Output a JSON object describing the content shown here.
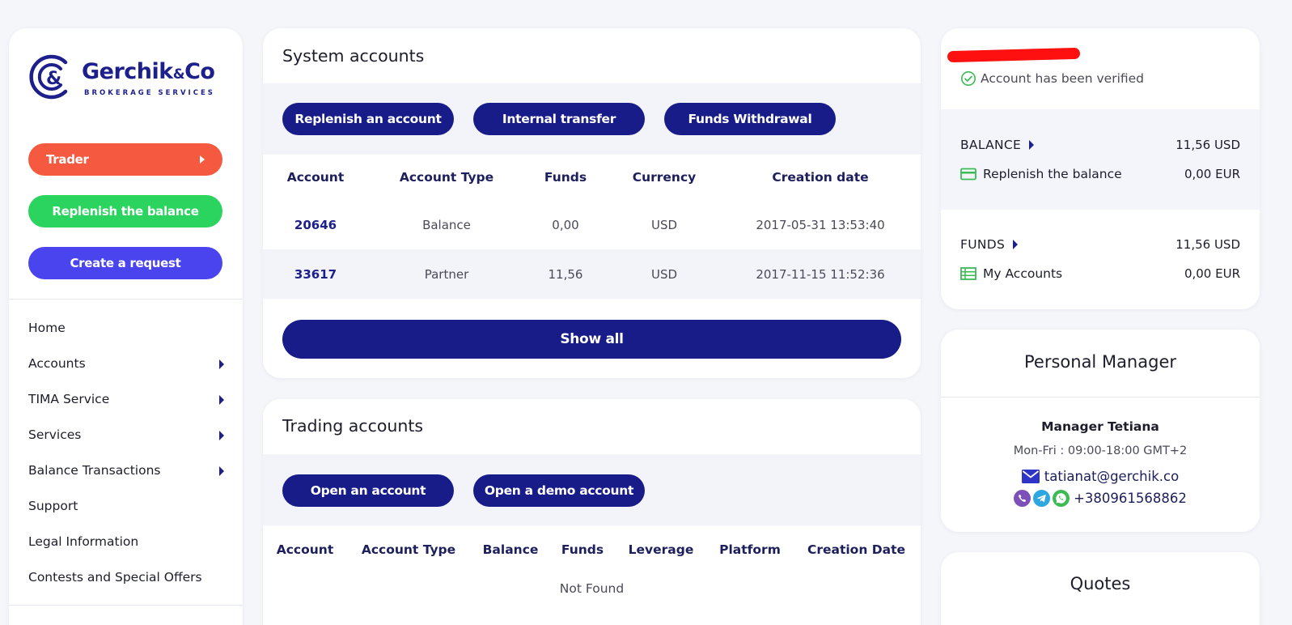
{
  "brand": {
    "name": "Gerchik",
    "amp": "&",
    "name_suffix": "Co",
    "tagline": "BROKERAGE SERVICES"
  },
  "sidebar": {
    "trader_label": "Trader",
    "replenish_label": "Replenish the balance",
    "create_request_label": "Create a request",
    "nav": [
      {
        "label": "Home",
        "has_submenu": false
      },
      {
        "label": "Accounts",
        "has_submenu": true
      },
      {
        "label": "TIMA Service",
        "has_submenu": true
      },
      {
        "label": "Services",
        "has_submenu": true
      },
      {
        "label": "Balance Transactions",
        "has_submenu": true
      },
      {
        "label": "Support",
        "has_submenu": false
      },
      {
        "label": "Legal Information",
        "has_submenu": false
      },
      {
        "label": "Contests and Special Offers",
        "has_submenu": false
      }
    ]
  },
  "system_accounts": {
    "title": "System accounts",
    "actions": [
      "Replenish an account",
      "Internal transfer",
      "Funds Withdrawal"
    ],
    "columns": [
      "Account",
      "Account Type",
      "Funds",
      "Currency",
      "Creation date"
    ],
    "rows": [
      {
        "account": "20646",
        "type": "Balance",
        "funds": "0,00",
        "currency": "USD",
        "created": "2017-05-31 13:53:40"
      },
      {
        "account": "33617",
        "type": "Partner",
        "funds": "11,56",
        "currency": "USD",
        "created": "2017-11-15 11:52:36"
      }
    ],
    "show_all_label": "Show all"
  },
  "trading_accounts": {
    "title": "Trading accounts",
    "actions": [
      "Open an account",
      "Open a demo account"
    ],
    "columns": [
      "Account",
      "Account Type",
      "Balance",
      "Funds",
      "Leverage",
      "Platform",
      "Creation Date"
    ],
    "empty_text": "Not Found"
  },
  "account_summary": {
    "verified_text": "Account has been verified",
    "balance_label": "BALANCE",
    "balance_usd": "11,56 USD",
    "replenish_label": "Replenish the balance",
    "replenish_eur": "0,00 EUR",
    "funds_label": "FUNDS",
    "funds_usd": "11,56 USD",
    "my_accounts_label": "My Accounts",
    "my_accounts_eur": "0,00 EUR"
  },
  "personal_manager": {
    "title": "Personal Manager",
    "name": "Manager Tetiana",
    "hours": "Mon-Fri : 09:00-18:00 GMT+2",
    "email": "tatianat@gerchik.co",
    "phone": "+380961568862"
  },
  "quotes": {
    "title": "Quotes"
  },
  "colors": {
    "navy_button": "#181c89",
    "trader_orange": "#f55a40",
    "replenish_green": "#2bd35f",
    "request_purple": "#4a44ef",
    "verified_green": "#3cba54",
    "redaction_red": "#ff1010"
  },
  "icons": {
    "logo": "gerchik-logo-icon",
    "verified": "check-circle-icon",
    "replenish": "credit-card-icon",
    "accounts": "table-list-icon",
    "email": "envelope-icon",
    "viber": "viber-icon",
    "telegram": "telegram-icon",
    "whatsapp": "whatsapp-icon"
  }
}
